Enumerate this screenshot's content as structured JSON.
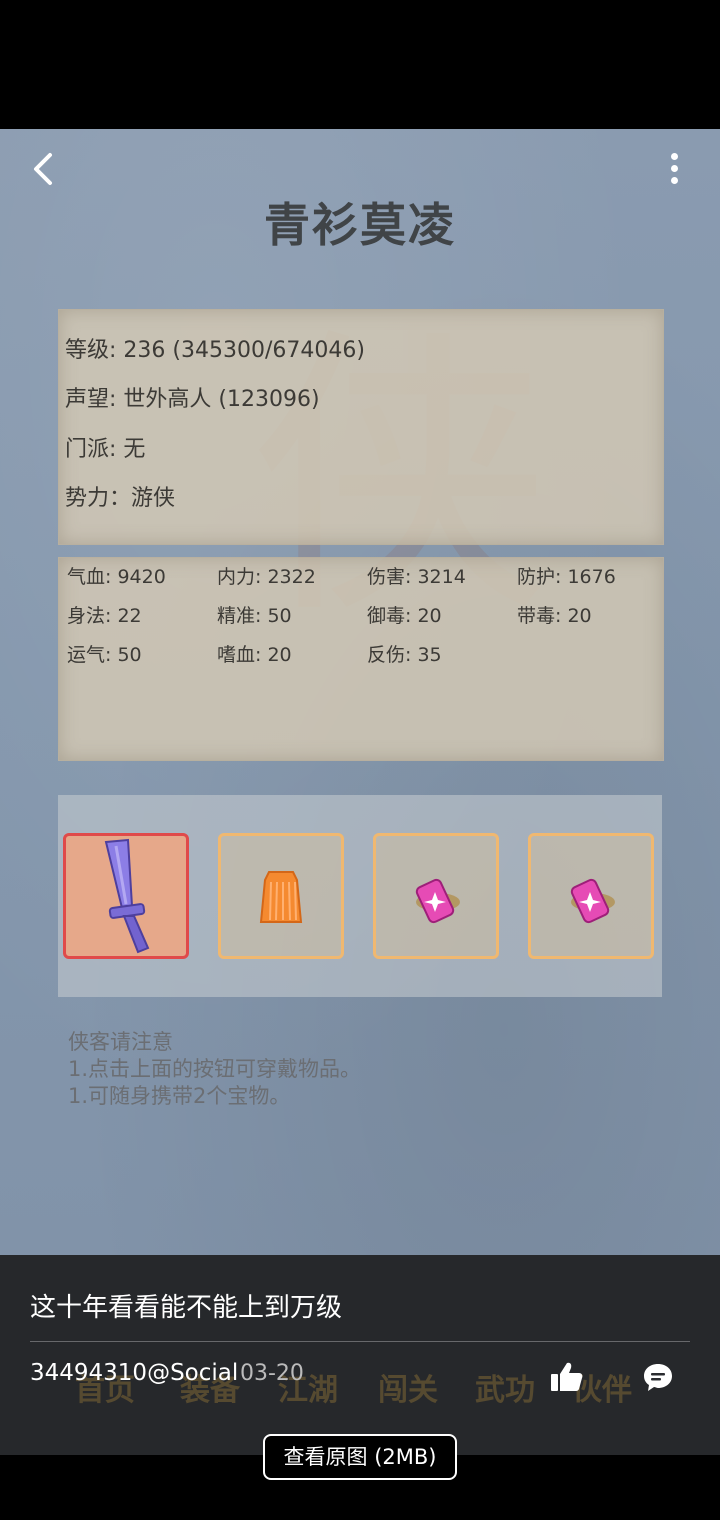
{
  "header": {
    "character_name": "青衫莫凌"
  },
  "info": [
    "等级: 236 (345300/674046)",
    "声望: 世外高人 (123096)",
    "门派: 无",
    "势力：游侠"
  ],
  "stats": [
    [
      "气血: 9420",
      "内力: 2322",
      "伤害: 3214",
      "防护: 1676"
    ],
    [
      "身法: 22",
      "精准: 50",
      "御毒: 20",
      "带毒: 20"
    ],
    [
      "运气: 50",
      "嗜血: 20",
      "反伤: 35",
      ""
    ]
  ],
  "equipment": [
    {
      "icon": "sword-icon",
      "selected": true
    },
    {
      "icon": "robe-icon",
      "selected": false
    },
    {
      "icon": "treasure-scroll-icon",
      "selected": false
    },
    {
      "icon": "treasure-scroll-icon",
      "selected": false
    }
  ],
  "notice": {
    "title": "侠客请注意",
    "line1": "1.点击上面的按钮可穿戴物品。",
    "line2": "1.可随身携带2个宝物。"
  },
  "bottom_nav_ghost": [
    "首页",
    "装备",
    "江湖",
    "闯关",
    "武功",
    "伙伴"
  ],
  "post": {
    "caption": "这十年看看能不能上到万级",
    "author": "34494310@Social",
    "date": "03-20",
    "view_original": "查看原图 (2MB)"
  },
  "colors": {
    "slot_border": "#f0b870",
    "slot_selected_border": "#e04a4a",
    "overlay": "#2a2c30"
  }
}
